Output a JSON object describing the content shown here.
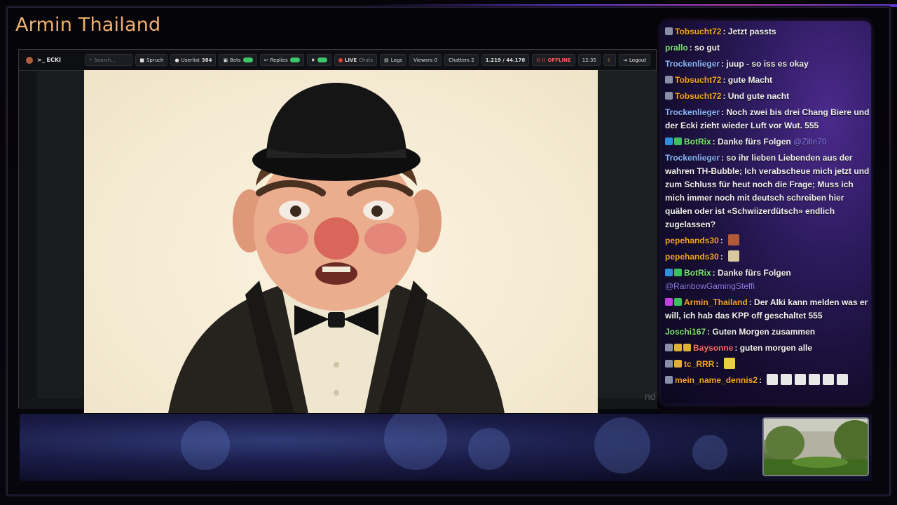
{
  "channel_title": "Armin Thailand",
  "toolbar": {
    "brand": ">_ ECKI",
    "search_placeholder": "Search...",
    "spruch": "Spruch",
    "userlist": "Userlist",
    "userlist_count": "384",
    "bots": "Bots",
    "replies": "Replies",
    "live": "LIVE",
    "chats": "Chats",
    "logs": "Logs",
    "viewers": "Viewers 0",
    "chatters": "Chatters 2",
    "follows": "1.219 / 44.178",
    "offline": "OFFLINE",
    "time": "12:35",
    "logout": "Logout"
  },
  "ghost_text": "nd",
  "chat": [
    {
      "user": "Tobsucht72",
      "color": "#f5a623",
      "badges": [
        "#8a8fa8"
      ],
      "text": "Jetzt passts"
    },
    {
      "user": "prallo",
      "color": "#7fe27a",
      "badges": [],
      "text": "so gut"
    },
    {
      "user": "Trockenlieger",
      "color": "#8db7ff",
      "badges": [],
      "text": "juup - so iss es okay"
    },
    {
      "user": "Tobsucht72",
      "color": "#f5a623",
      "badges": [
        "#8a8fa8"
      ],
      "text": "gute Macht"
    },
    {
      "user": "Tobsucht72",
      "color": "#f5a623",
      "badges": [
        "#8a8fa8"
      ],
      "text": "Und gute nacht"
    },
    {
      "user": "Trockenlieger",
      "color": "#8db7ff",
      "badges": [],
      "text": "Noch zwei bis drei Chang Biere und der Ecki zieht wieder Luft vor Wut. 555"
    },
    {
      "user": "BotRix",
      "color": "#7fe27a",
      "badges": [
        "#2f8fd8",
        "#3bbf5f"
      ],
      "text": "Danke fürs Folgen",
      "mention": "@Zille70"
    },
    {
      "user": "Trockenlieger",
      "color": "#8db7ff",
      "badges": [],
      "text": "so ihr lieben Liebenden aus der wahren TH-Bubble; Ich verabscheue mich jetzt und zum Schluss für heut noch die Frage; Muss ich mich immer noch mit deutsch schreiben hier quälen oder ist «Schwiizerdütsch» endlich zugelassen?"
    },
    {
      "user": "pepehands30",
      "color": "#f5a623",
      "badges": [],
      "text": "",
      "emotes": [
        "#b05a3a"
      ]
    },
    {
      "user": "pepehands30",
      "color": "#f5a623",
      "badges": [],
      "text": "",
      "emotes": [
        "#d8c8a0"
      ]
    },
    {
      "user": "BotRix",
      "color": "#7fe27a",
      "badges": [
        "#2f8fd8",
        "#3bbf5f"
      ],
      "text": "Danke fürs Folgen",
      "mention": "@RainbowGamingSteffi"
    },
    {
      "user": "Armin_Thailand",
      "color": "#f5a623",
      "badges": [
        "#c040e0",
        "#3bbf5f"
      ],
      "text": "Der Alki kann melden was er will, ich hab das KPP off geschaltet 555"
    },
    {
      "user": "Joschi167",
      "color": "#7fe27a",
      "badges": [],
      "text": "Guten Morgen zusammen"
    },
    {
      "user": "Baysonne",
      "color": "#ff6b6b",
      "badges": [
        "#8a8fa8",
        "#e0b030",
        "#e0b030"
      ],
      "text": "guten morgen alle"
    },
    {
      "user": "tc_RRR",
      "color": "#f5a623",
      "badges": [
        "#8a8fa8",
        "#e0b030"
      ],
      "text": "",
      "emotes": [
        "#e8d040"
      ]
    },
    {
      "user": "mein_name_dennis2",
      "color": "#f5a623",
      "badges": [
        "#8a8fa8"
      ],
      "text": "",
      "emotes": [
        "#e8e8e8",
        "#e8e8e8",
        "#e8e8e8",
        "#e8e8e8",
        "#e8e8e8",
        "#e8e8e8"
      ]
    }
  ]
}
